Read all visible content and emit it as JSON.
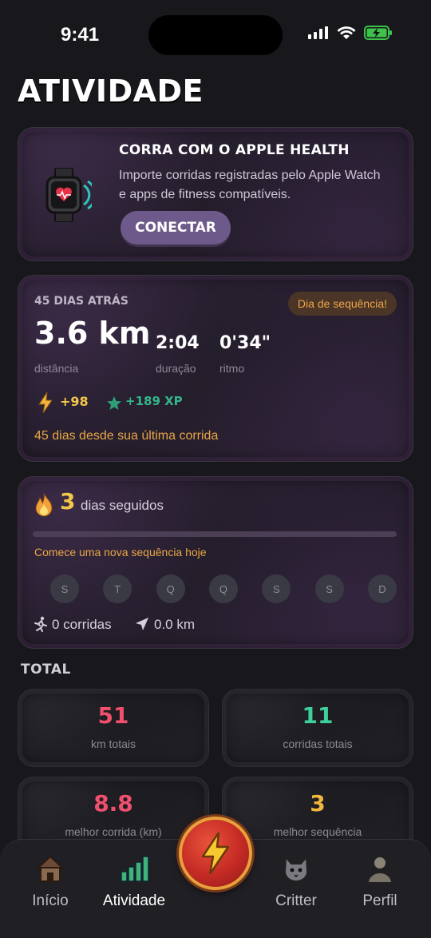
{
  "status_bar": {
    "time": "9:41"
  },
  "page_title": "ATIVIDADE",
  "health_card": {
    "title": "CORRA COM O APPLE HEALTH",
    "description": "Importe corridas registradas pelo Apple Watch e apps de fitness compatíveis.",
    "button_label": "CONECTAR"
  },
  "last_run": {
    "ago": "45 DIAS ATRÁS",
    "badge": "Dia de sequência!",
    "distance_value": "3.6 km",
    "distance_label": "distância",
    "duration_value": "2:04",
    "duration_label": "duração",
    "pace_value": "0'34\"",
    "pace_label": "ritmo",
    "energy": "+98",
    "xp": "+189 XP",
    "since_text": "45 dias desde sua última corrida"
  },
  "streak": {
    "count": "3",
    "label": "dias seguidos",
    "hint": "Comece uma nova sequência hoje",
    "days": [
      "S",
      "T",
      "Q",
      "Q",
      "S",
      "S",
      "D"
    ],
    "runs_text": "0 corridas",
    "km_text": "0.0 km"
  },
  "totals": {
    "title": "TOTAL",
    "stats": [
      {
        "value": "51",
        "label": "km totais",
        "color": "#f0506e"
      },
      {
        "value": "11",
        "label": "corridas totais",
        "color": "#3fcf9a"
      },
      {
        "value": "8.8",
        "label": "melhor corrida (km)",
        "color": "#f0506e"
      },
      {
        "value": "3",
        "label": "melhor sequência",
        "color": "#f2b640"
      }
    ]
  },
  "tabbar": {
    "tabs": [
      {
        "label": "Início",
        "icon": "house-icon"
      },
      {
        "label": "Atividade",
        "icon": "chart-icon"
      },
      {
        "label": "Critter",
        "icon": "cat-icon"
      },
      {
        "label": "Perfil",
        "icon": "person-icon"
      }
    ],
    "center_icon": "lightning-icon"
  },
  "colors": {
    "accent": "#6e5a8a",
    "orange": "#e8a646",
    "gold": "#f2c64a",
    "green": "#35b58b"
  }
}
